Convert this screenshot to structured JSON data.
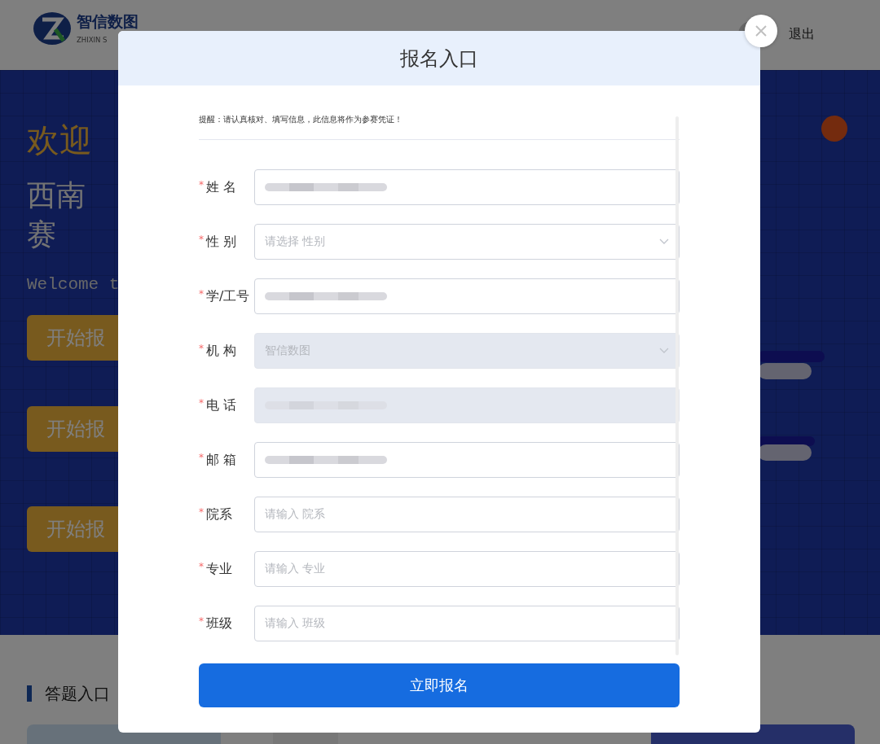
{
  "page": {
    "logo": {
      "name": "智信数图",
      "subtitle": "ZHIXIN S"
    },
    "logout": "退出",
    "hero": {
      "welcome": "欢迎",
      "title_line_1": "西南",
      "title_line_2": "赛",
      "english": "Welcome t",
      "buttons": [
        "开始报",
        "开始报",
        "开始报"
      ]
    },
    "section": {
      "title": "答题入口"
    }
  },
  "dialog": {
    "title": "报名入口",
    "notice": "提醒：请认真核对、填写信息，此信息将作为参赛凭证！",
    "fields": [
      {
        "marker": "*",
        "label": "姓 名",
        "kind": "input",
        "redacted": true,
        "disabled": false
      },
      {
        "marker": "*",
        "label": "性 别",
        "kind": "select",
        "placeholder": "请选择 性别",
        "disabled": false
      },
      {
        "marker": "*",
        "label": "学/工号",
        "kind": "input",
        "redacted": true,
        "disabled": false
      },
      {
        "marker": "*",
        "label": "机 构",
        "kind": "select",
        "value": "智信数图",
        "disabled": true
      },
      {
        "marker": "*",
        "label": "电 话",
        "kind": "input",
        "redacted": true,
        "disabled": true
      },
      {
        "marker": "*",
        "label": "邮 箱",
        "kind": "input",
        "redacted": true,
        "disabled": false
      },
      {
        "marker": "*",
        "label": "院系",
        "kind": "input",
        "placeholder": "请输入 院系",
        "disabled": false
      },
      {
        "marker": "*",
        "label": "专业",
        "kind": "input",
        "placeholder": "请输入 专业",
        "disabled": false
      },
      {
        "marker": "*",
        "label": "班级",
        "kind": "input",
        "placeholder": "请输入 班级",
        "disabled": false
      }
    ],
    "submit": "立即报名"
  }
}
